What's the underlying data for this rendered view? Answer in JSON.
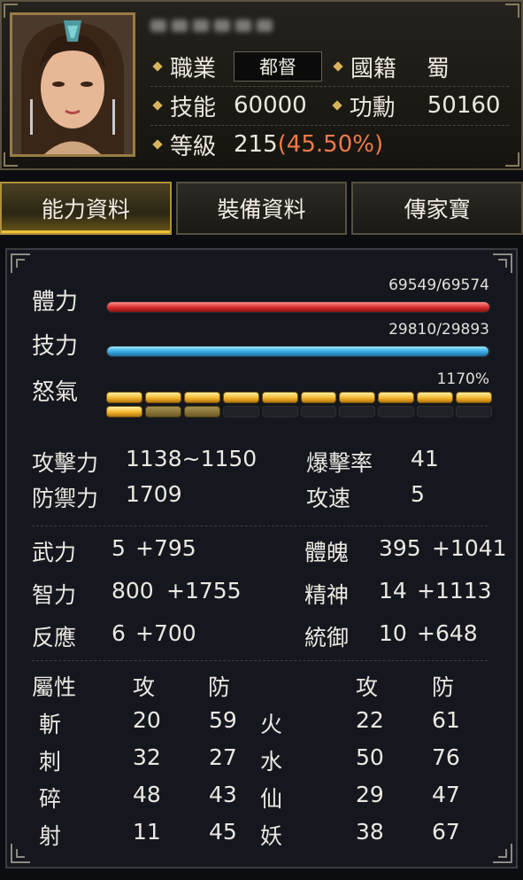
{
  "header": {
    "name": "",
    "job_label": "職業",
    "job_value": "都督",
    "country_label": "國籍",
    "country_value": "蜀",
    "skill_label": "技能",
    "skill_value": "60000",
    "merit_label": "功勳",
    "merit_value": "50160",
    "level_label": "等級",
    "level_value": "215",
    "level_pct": "(45.50%)"
  },
  "tabs": [
    "能力資料",
    "裝備資料",
    "傳家寶"
  ],
  "vitals": {
    "hp_label": "體力",
    "hp_text": "69549/69574",
    "hp_fraction": 0.9996,
    "mp_label": "技力",
    "mp_text": "29810/29893",
    "mp_fraction": 0.9972,
    "rage_label": "怒氣",
    "rage_text": "1170%",
    "rage_full_segments": 11,
    "rage_dim_segments": 2,
    "rage_total_segments": 20
  },
  "combat": {
    "attack_label": "攻擊力",
    "attack_value": "1138~1150",
    "crit_label": "爆擊率",
    "crit_value": "41",
    "defense_label": "防禦力",
    "defense_value": "1709",
    "speed_label": "攻速",
    "speed_value": "5"
  },
  "stats": [
    {
      "label": "武力",
      "base": "5",
      "bonus": "+795"
    },
    {
      "label": "體魄",
      "base": "395",
      "bonus": "+1041"
    },
    {
      "label": "智力",
      "base": "800",
      "bonus": "+1755"
    },
    {
      "label": "精神",
      "base": "14",
      "bonus": "+1113"
    },
    {
      "label": "反應",
      "base": "6",
      "bonus": "+700"
    },
    {
      "label": "統御",
      "base": "10",
      "bonus": "+648"
    }
  ],
  "attributes": {
    "header": {
      "attr": "屬性",
      "atk": "攻",
      "def": "防",
      "atk2": "攻",
      "def2": "防"
    },
    "rows": [
      {
        "name": "斬",
        "atk": "20",
        "def": "59",
        "name2": "火",
        "atk2": "22",
        "def2": "61"
      },
      {
        "name": "刺",
        "atk": "32",
        "def": "27",
        "name2": "水",
        "atk2": "50",
        "def2": "76"
      },
      {
        "name": "碎",
        "atk": "48",
        "def": "43",
        "name2": "仙",
        "atk2": "29",
        "def2": "47"
      },
      {
        "name": "射",
        "atk": "11",
        "def": "45",
        "name2": "妖",
        "atk2": "38",
        "def2": "67"
      }
    ]
  },
  "colors": {
    "gold": "#e8b233",
    "green": "#8fe06e",
    "orange": "#ee7a4a",
    "hp": "#d72b2b",
    "mp": "#33a6e0"
  }
}
